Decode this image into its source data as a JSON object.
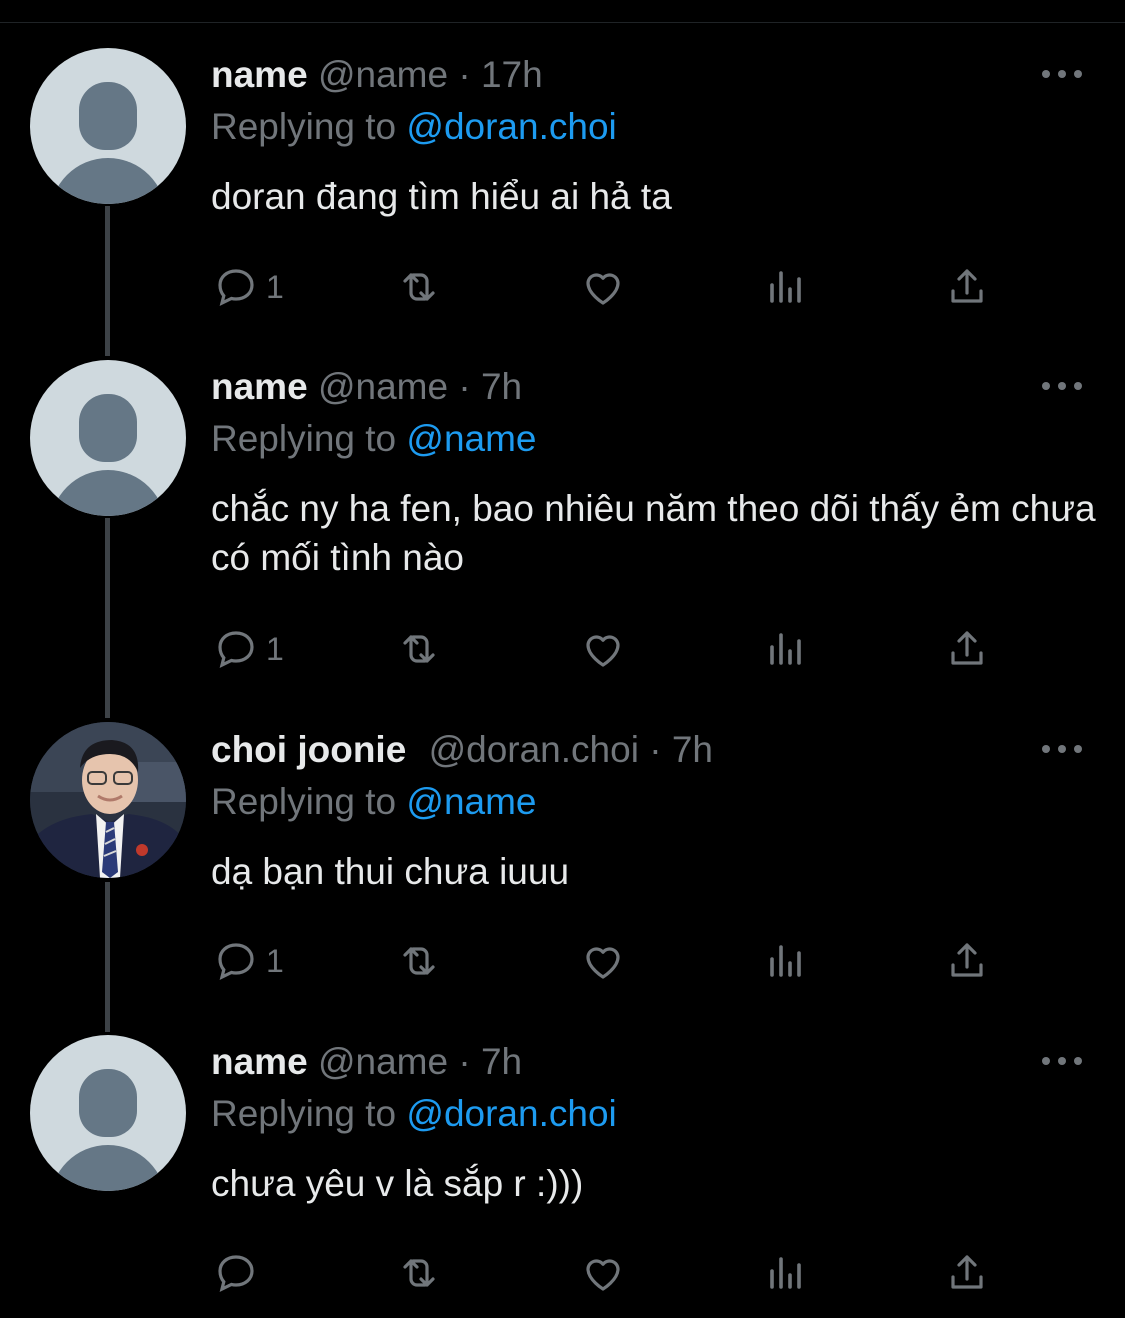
{
  "colors": {
    "background": "#000000",
    "text": "#e7e9ea",
    "muted": "#71767b",
    "mention": "#1d9bf0",
    "connector": "#3d4247"
  },
  "tweets": [
    {
      "display_name": "name",
      "handle": "@name",
      "separator": "·",
      "time": "17h",
      "replying_prefix": "Replying to",
      "replying_to": "@doran.choi",
      "text": "doran đang tìm hiểu ai hả ta",
      "avatar": "default-avatar-icon",
      "reply_count": "1"
    },
    {
      "display_name": "name",
      "handle": "@name",
      "separator": "·",
      "time": "7h",
      "replying_prefix": "Replying to",
      "replying_to": "@name",
      "text": "chắc ny ha fen, bao nhiêu năm theo dõi thấy ẻm chưa có mối tình nào",
      "avatar": "default-avatar-icon",
      "reply_count": "1"
    },
    {
      "display_name": "choi joonie",
      "handle": "@doran.choi",
      "separator": "·",
      "time": "7h",
      "replying_prefix": "Replying to",
      "replying_to": "@name",
      "text": "dạ bạn thui chưa iuuu",
      "avatar": "profile-photo",
      "reply_count": "1"
    },
    {
      "display_name": "name",
      "handle": "@name",
      "separator": "·",
      "time": "7h",
      "replying_prefix": "Replying to",
      "replying_to": "@doran.choi",
      "text": "chưa yêu v là sắp r :)))",
      "avatar": "default-avatar-icon",
      "reply_count": ""
    }
  ],
  "action_icons": [
    "reply-icon",
    "retweet-icon",
    "like-icon",
    "views-icon",
    "share-icon"
  ]
}
